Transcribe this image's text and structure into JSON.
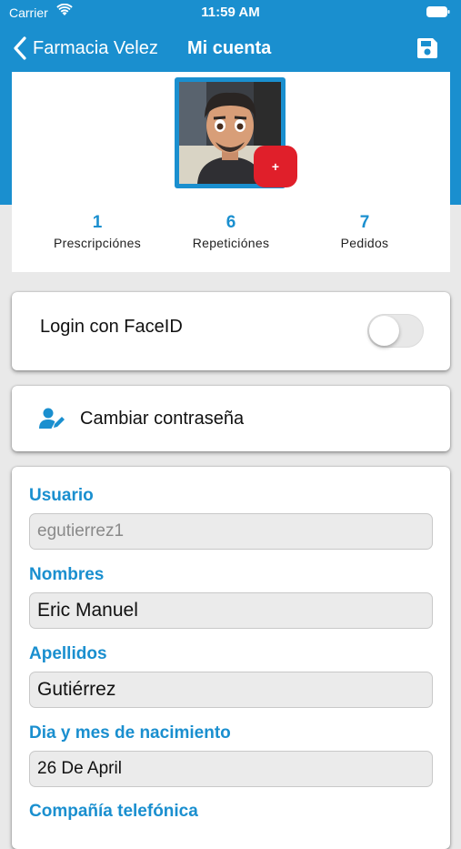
{
  "status_bar": {
    "carrier": "Carrier",
    "time": "11:59 AM"
  },
  "nav": {
    "back_label": "Farmacia Velez",
    "title": "Mi cuenta"
  },
  "profile": {
    "add_photo_label": "+",
    "stats": [
      {
        "value": "1",
        "label": "Prescripciónes"
      },
      {
        "value": "6",
        "label": "Repeticiónes"
      },
      {
        "value": "7",
        "label": "Pedidos"
      }
    ]
  },
  "faceid": {
    "label": "Login con FaceID",
    "enabled": false
  },
  "password": {
    "label": "Cambiar contraseña"
  },
  "form": {
    "usuario": {
      "label": "Usuario",
      "value": "egutierrez1"
    },
    "nombres": {
      "label": "Nombres",
      "value": "Eric Manuel"
    },
    "apellidos": {
      "label": "Apellidos",
      "value": "Gutiérrez"
    },
    "nacimiento": {
      "label": "Dia y mes de nacimiento",
      "value": "26 De April"
    },
    "compania": {
      "label": "Compañía telefónica"
    }
  },
  "colors": {
    "accent": "#1a8fcf",
    "add_photo": "#e01f2a",
    "background": "#e9e9e9"
  }
}
